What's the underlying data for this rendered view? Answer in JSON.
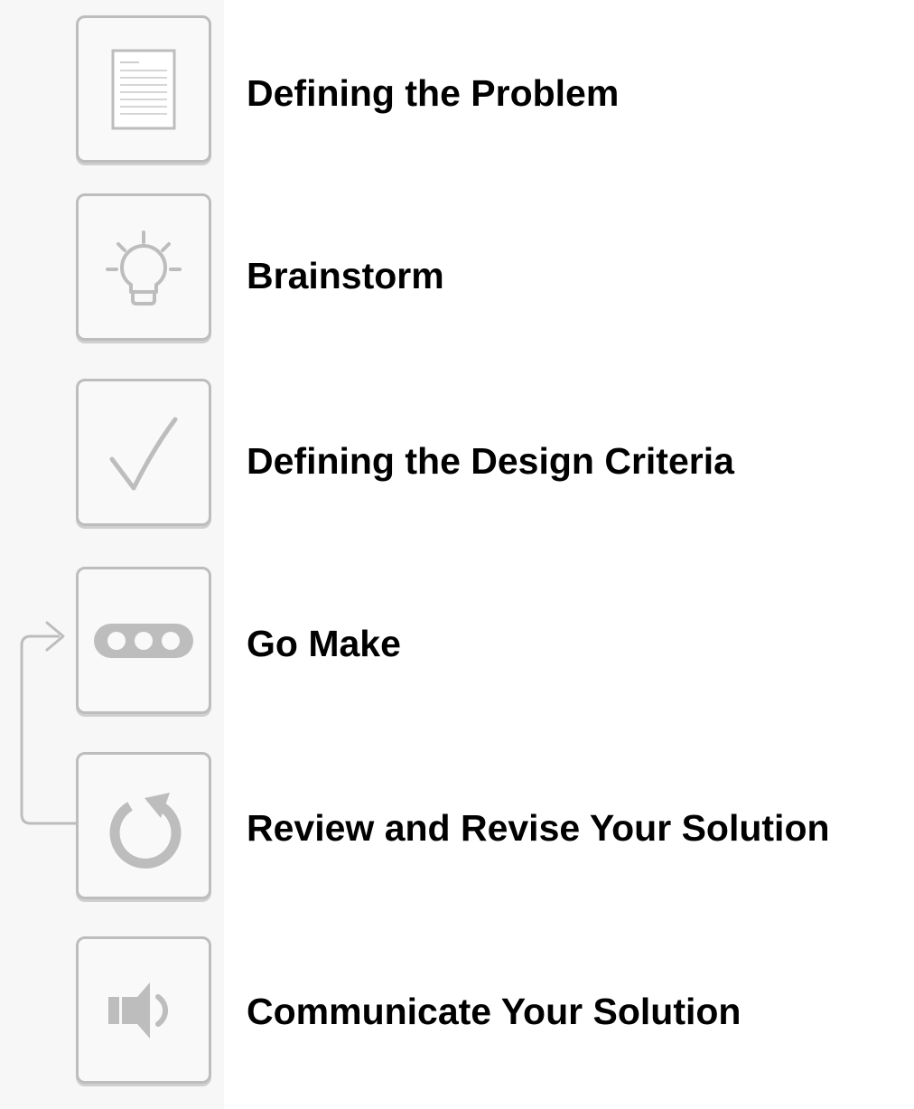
{
  "steps": [
    {
      "label": "Defining the Problem",
      "icon": "document-icon"
    },
    {
      "label": "Brainstorm",
      "icon": "lightbulb-icon"
    },
    {
      "label": "Defining the Design Criteria",
      "icon": "checkmark-icon"
    },
    {
      "label": "Go Make",
      "icon": "dots-icon"
    },
    {
      "label": "Review and Revise Your Solution",
      "icon": "refresh-icon"
    },
    {
      "label": "Communicate Your Solution",
      "icon": "speaker-icon"
    }
  ],
  "colors": {
    "icon_stroke": "#bdbdbd",
    "box_border": "#bdbdbd",
    "panel_background": "#f7f7f7",
    "label_text": "#000000"
  }
}
